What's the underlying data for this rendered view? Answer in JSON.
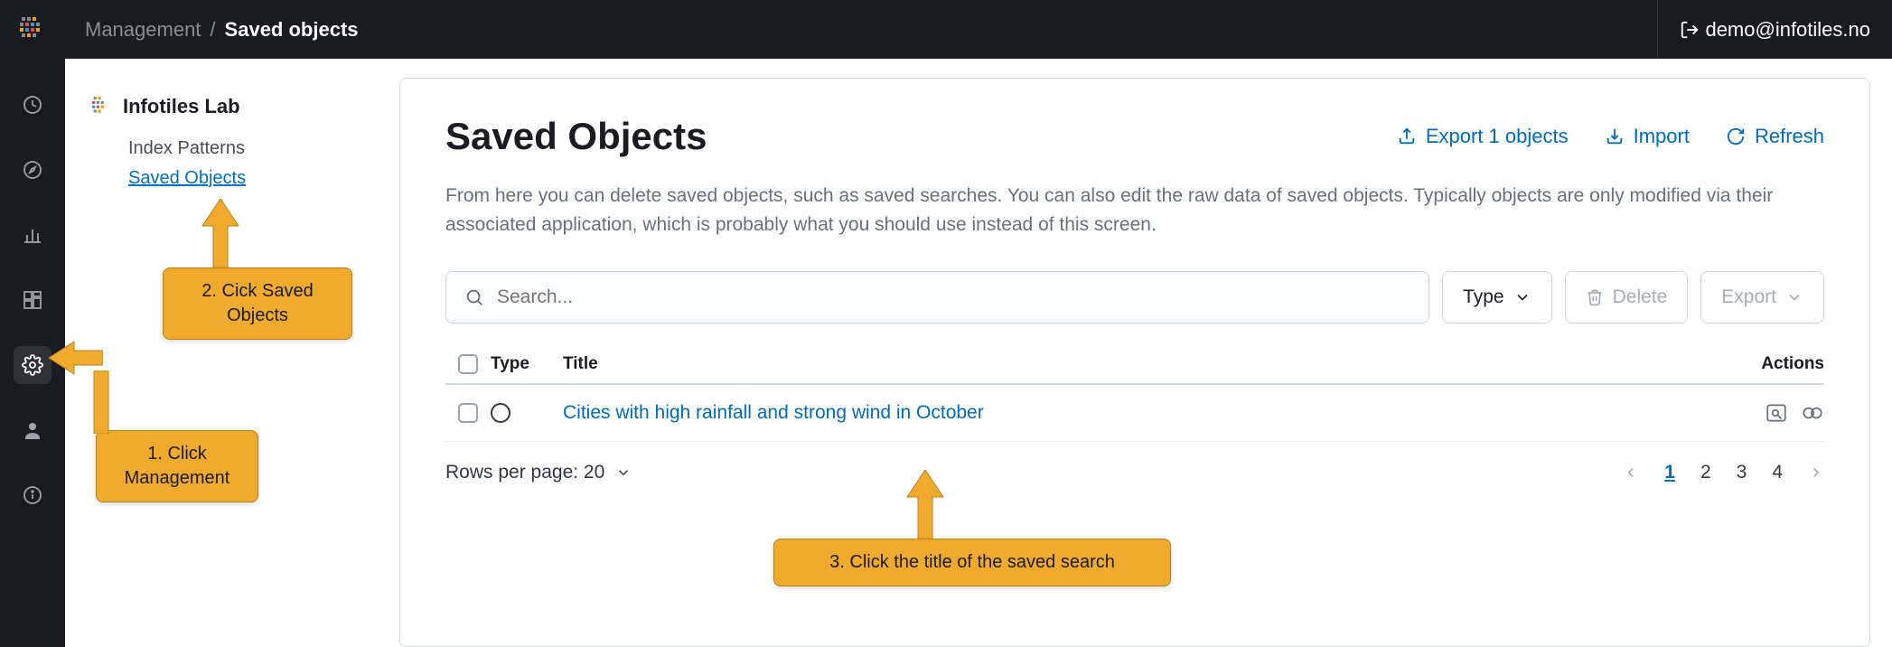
{
  "header": {
    "breadcrumb_root": "Management",
    "breadcrumb_sep": "/",
    "breadcrumb_current": "Saved objects",
    "user_email": "demo@infotiles.no"
  },
  "sidebar": {
    "title": "Infotiles Lab",
    "links": [
      {
        "label": "Index Patterns",
        "active": false
      },
      {
        "label": "Saved Objects",
        "active": true
      }
    ]
  },
  "main": {
    "title": "Saved Objects",
    "actions": {
      "export": "Export 1 objects",
      "import": "Import",
      "refresh": "Refresh"
    },
    "description": "From here you can delete saved objects, such as saved searches. You can also edit the raw data of saved objects. Typically objects are only modified via their associated application, which is probably what you should use instead of this screen.",
    "search_placeholder": "Search...",
    "type_button": "Type",
    "delete_button": "Delete",
    "export_button": "Export",
    "columns": {
      "type": "Type",
      "title": "Title",
      "actions": "Actions"
    },
    "rows": [
      {
        "title": "Cities with high rainfall and strong wind in October"
      }
    ],
    "rows_per_page": "Rows per page: 20",
    "pagination": {
      "pages": [
        "1",
        "2",
        "3",
        "4"
      ],
      "current": "1"
    }
  },
  "callouts": {
    "c1": "1. Click Management",
    "c2": "2. Cick Saved Objects",
    "c3": "3. Click the title of the saved search"
  }
}
